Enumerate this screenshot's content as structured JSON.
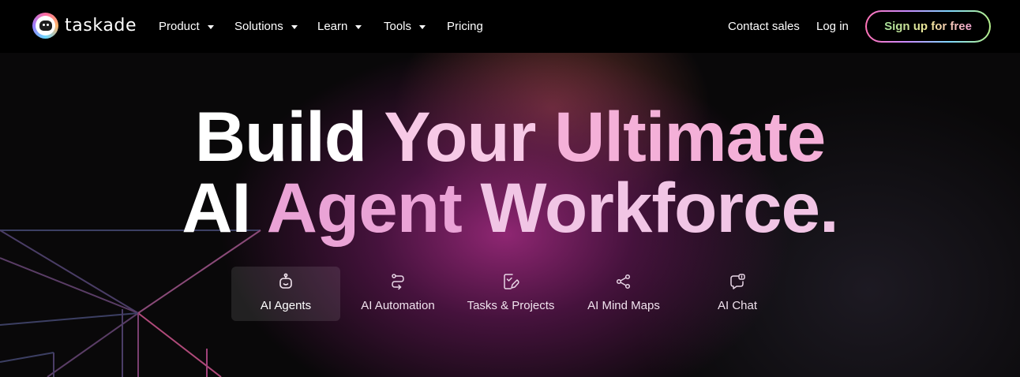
{
  "brand": {
    "name": "taskade",
    "logo_icon": "taskade-robot-logo"
  },
  "nav": {
    "items": [
      {
        "label": "Product",
        "has_dropdown": true
      },
      {
        "label": "Solutions",
        "has_dropdown": true
      },
      {
        "label": "Learn",
        "has_dropdown": true
      },
      {
        "label": "Tools",
        "has_dropdown": true
      },
      {
        "label": "Pricing",
        "has_dropdown": false
      }
    ],
    "contact_sales": "Contact sales",
    "login": "Log in",
    "signup": "Sign up for free"
  },
  "hero": {
    "headline_line1": [
      "Build",
      "Your",
      "Ultimate"
    ],
    "headline_line2": [
      "AI",
      "Agent",
      "Workforce."
    ]
  },
  "tabs": [
    {
      "label": "AI Agents",
      "icon": "robot-icon",
      "active": true
    },
    {
      "label": "AI Automation",
      "icon": "automation-flow-icon",
      "active": false
    },
    {
      "label": "Tasks & Projects",
      "icon": "task-edit-icon",
      "active": false
    },
    {
      "label": "AI Mind Maps",
      "icon": "mind-map-icon",
      "active": false
    },
    {
      "label": "AI Chat",
      "icon": "chat-bubble-icon",
      "active": false
    }
  ],
  "colors": {
    "background": "#000000",
    "hero_glow": "#962878",
    "signup_gradient": [
      "#ff72b6",
      "#c98bff",
      "#7fd7ff",
      "#b6f08a"
    ]
  }
}
